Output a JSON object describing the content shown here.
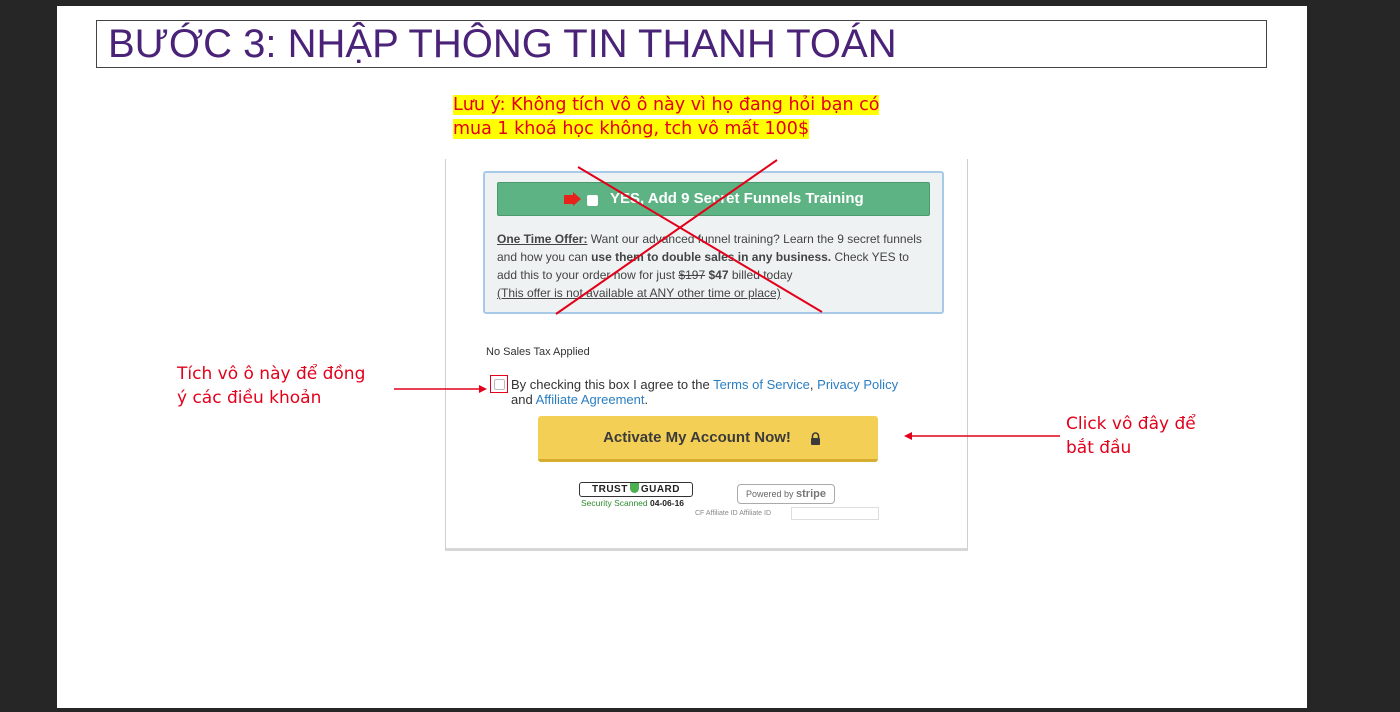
{
  "slide": {
    "title": "BƯỚC 3: NHẬP THÔNG TIN THANH TOÁN",
    "note_line1": "Lưu ý: Không tích vô ô này vì họ đang hỏi bạn có",
    "note_line2": "mua 1 khoá học không, tch vô mất 100$",
    "annotation_left_line1": "Tích vô ô này để đồng",
    "annotation_left_line2": "ý các điều khoản",
    "annotation_right_line1": "Click vô đây để",
    "annotation_right_line2": "bắt đầu"
  },
  "offer": {
    "yes_label": "YES, Add 9 Secret Funnels Training",
    "heading": "One Time Offer:",
    "text1": " Want our advanced funnel training? Learn the 9 secret funnels and how you can ",
    "text_bold": "use them to double sales in any business.",
    "text2": " Check YES to add this to your order now for just ",
    "old_price": "$197",
    "new_price": "$47",
    "text3": " billed today",
    "disclaimer": "(This offer is not available at ANY other time or place)"
  },
  "checkout": {
    "tax_text": "No Sales Tax Applied",
    "agree_prefix": "By checking this box I agree to the ",
    "terms_link": "Terms of Service",
    "comma": ", ",
    "privacy_link": "Privacy Policy",
    "and_text": " and ",
    "affiliate_link": "Affiliate Agreement",
    "period": ".",
    "activate_label": "Activate My Account Now!",
    "trust_badge_left": "TRUST",
    "trust_badge_right": "GUARD",
    "trust_sub": "Security Scanned",
    "trust_date": "04-06-16",
    "stripe_prefix": "Powered by ",
    "stripe_brand": "stripe",
    "affiliate_id_label": "CF Affiliate ID Affiliate ID"
  },
  "icons": {
    "lock": "lock-icon",
    "arrow": "arrow-right-icon",
    "shield": "shield-icon"
  },
  "colors": {
    "title": "#4a2378",
    "annotation": "#e3001b",
    "highlight": "#ffff00",
    "yes_button": "#5eb384",
    "activate_button": "#f4cf55",
    "link": "#2a7ec2"
  }
}
